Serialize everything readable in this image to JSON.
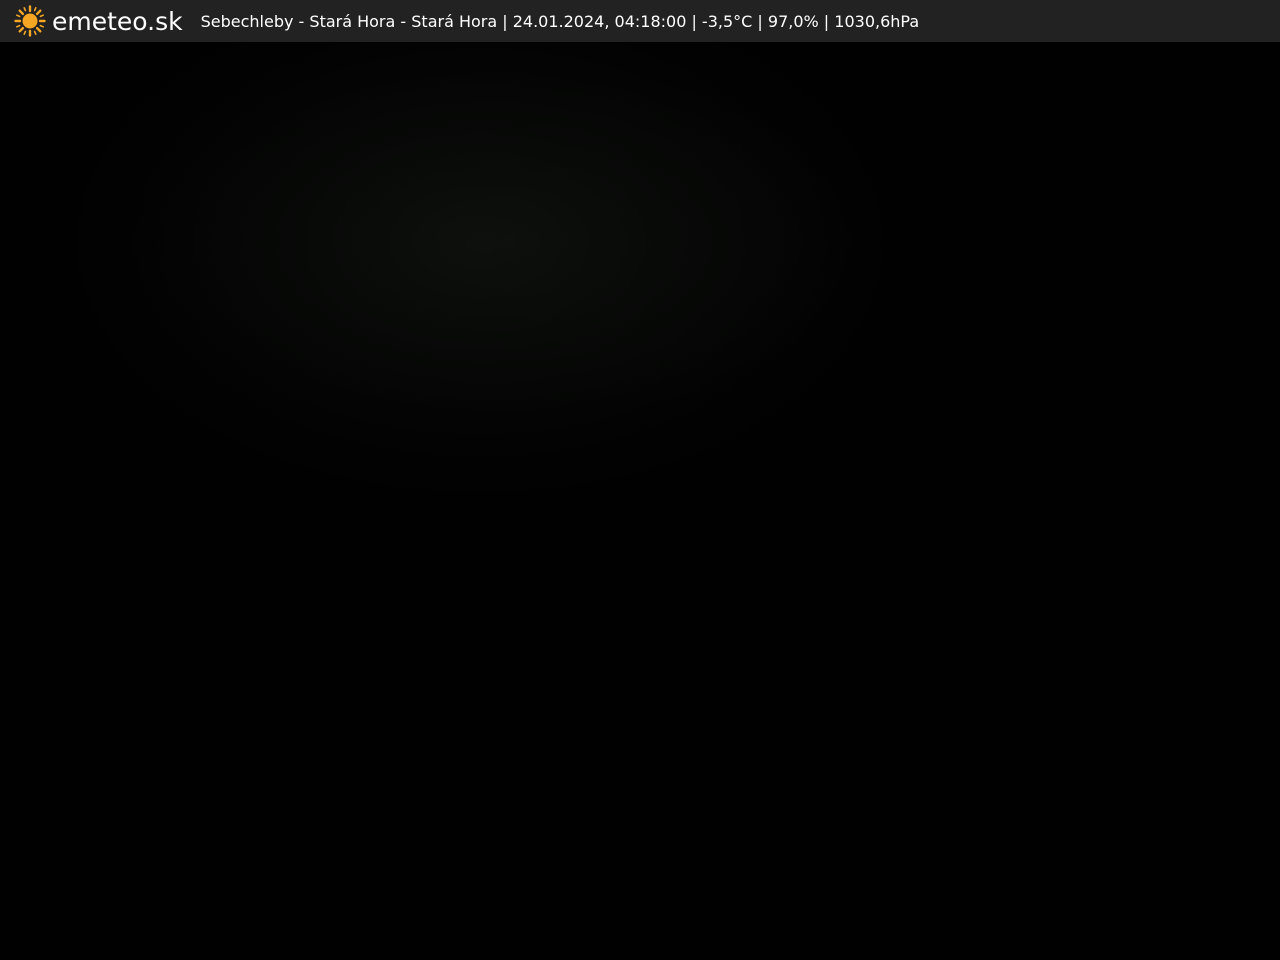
{
  "header": {
    "logo_text": "emeteo.sk",
    "info": "Sebechleby - Stará Hora - Stará Hora | 24.01.2024, 04:18:00 | -3,5°C | 97,0% | 1030,6hPa",
    "icon": "sun-icon",
    "icon_color": "#f5a623",
    "background": "#222222"
  }
}
